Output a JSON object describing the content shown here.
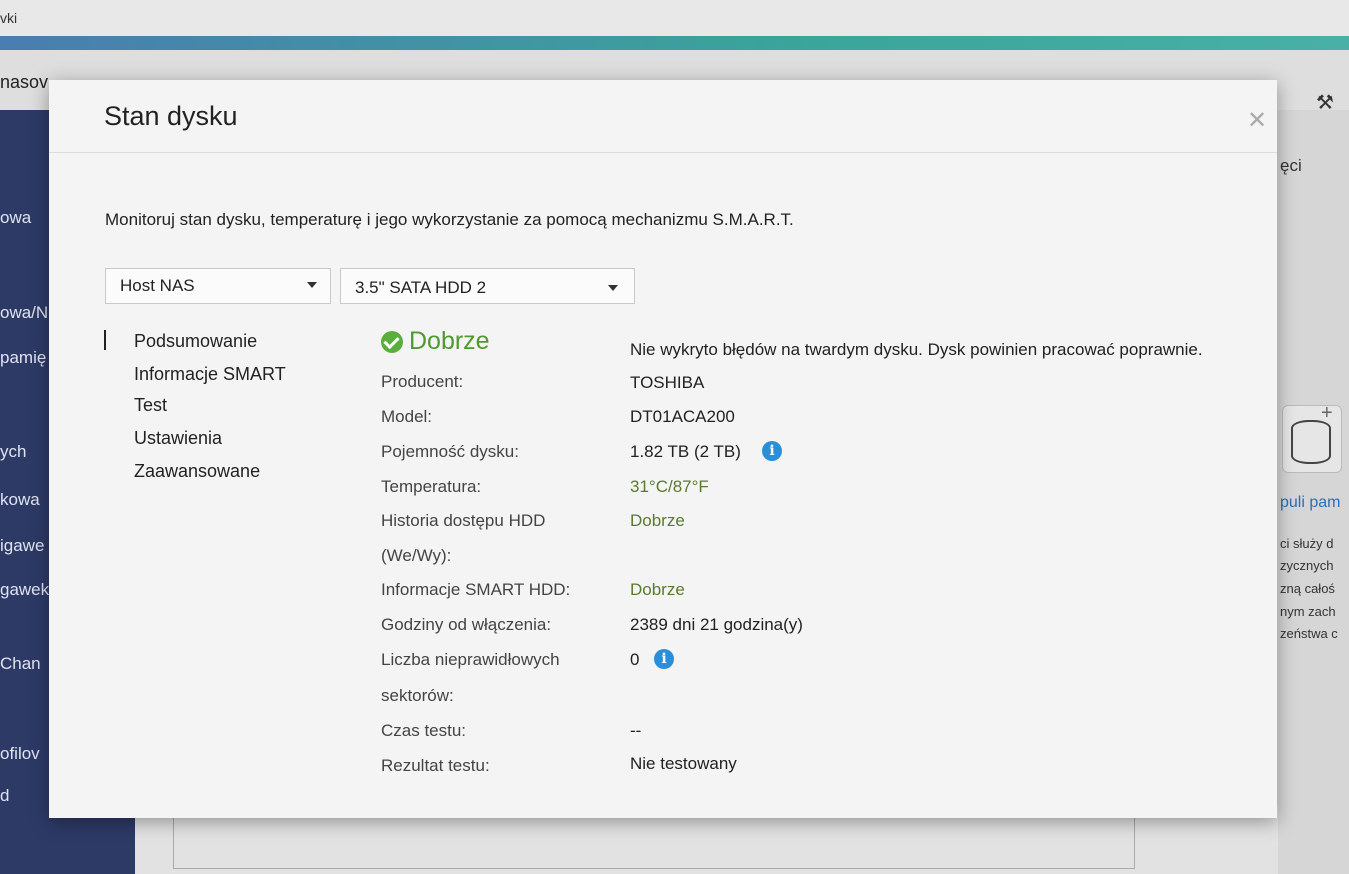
{
  "background": {
    "window_title": "vki",
    "header_text": "nasov",
    "right_header": "ęci",
    "sidebar_items": [
      "owa",
      "owa/N",
      "pamię",
      "ych",
      "kowa",
      "igawe",
      "gawek",
      "Chan",
      "ofilov",
      "d"
    ],
    "right_link": "puli pam",
    "right_lines": [
      "ci służy d",
      "zycznych",
      "zną całoś",
      "nym zach",
      "zeństwa c"
    ]
  },
  "dialog": {
    "title": "Stan dysku",
    "close_icon": "close-icon",
    "description": "Monitoruj stan dysku, temperaturę i jego wykorzystanie za pomocą mechanizmu S.M.A.R.T.",
    "host_select": "Host NAS",
    "disk_select": "3.5\" SATA HDD 2",
    "nav": [
      "Podsumowanie",
      "Informacje SMART",
      "Test",
      "Ustawienia",
      "Zaawansowane"
    ],
    "status": {
      "icon": "check-circle-icon",
      "text": "Dobrze",
      "message": "Nie wykryto błędów na twardym dysku. Dysk powinien pracować poprawnie."
    },
    "rows": {
      "producer_label": "Producent:",
      "producer_value": "TOSHIBA",
      "model_label": "Model:",
      "model_value": "DT01ACA200",
      "capacity_label": "Pojemność dysku:",
      "capacity_value": "1.82 TB (2 TB)",
      "temp_label": "Temperatura:",
      "temp_value": "31°C/87°F",
      "history_label_1": "Historia dostępu HDD",
      "history_label_2": "(We/Wy):",
      "history_value": "Dobrze",
      "smart_label": "Informacje SMART HDD:",
      "smart_value": "Dobrze",
      "hours_label": "Godziny od włączenia:",
      "hours_value": "2389 dni 21 godzina(y)",
      "bad_label_1": "Liczba nieprawidłowych",
      "bad_label_2": "sektorów:",
      "bad_value": "0",
      "test_time_label": "Czas testu:",
      "test_time_value": "--",
      "test_result_label": "Rezultat testu:",
      "test_result_value": "Nie testowany"
    },
    "info_glyph": "i"
  },
  "colors": {
    "sidebar": "#2d3a66",
    "ok_green": "#5aae3d",
    "info_blue": "#2b8ed8"
  }
}
